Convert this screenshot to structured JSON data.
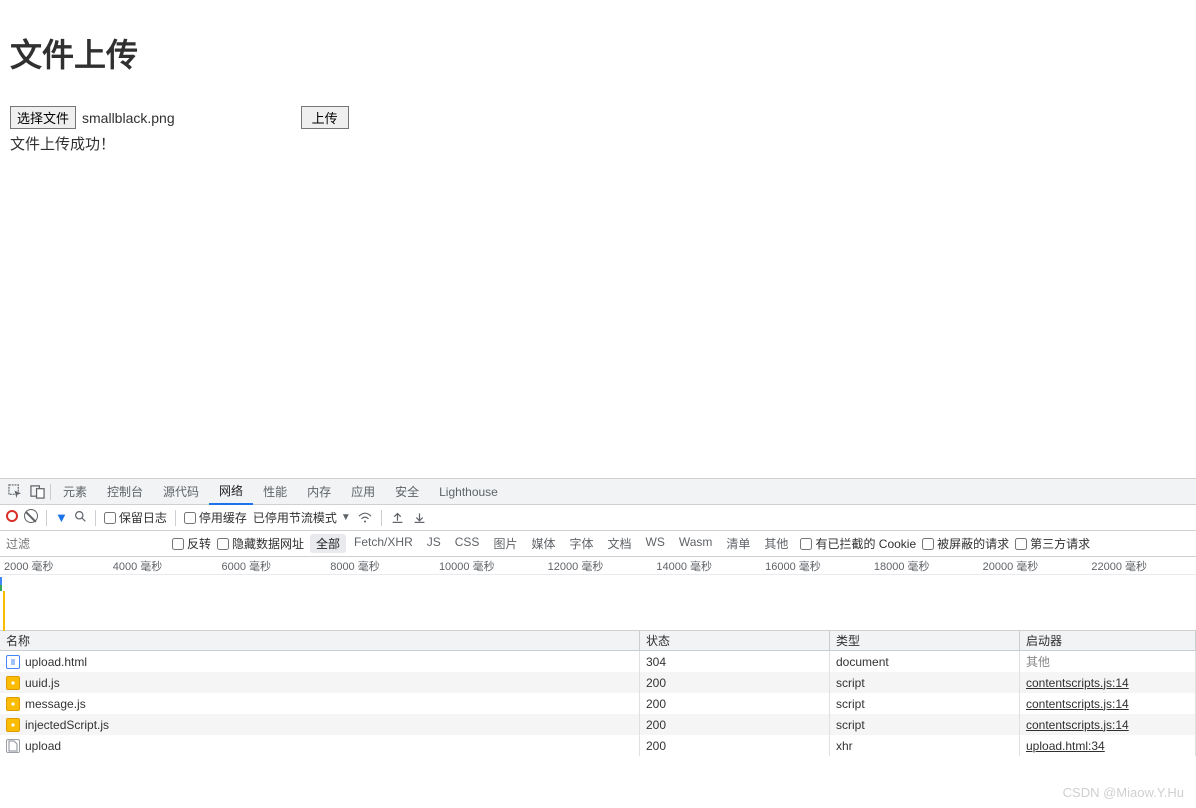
{
  "page": {
    "title": "文件上传",
    "choose_file_btn": "选择文件",
    "filename": "smallblack.png",
    "upload_btn": "上传",
    "success_msg": "文件上传成功！"
  },
  "devtools": {
    "tabs": [
      "元素",
      "控制台",
      "源代码",
      "网络",
      "性能",
      "内存",
      "应用",
      "安全",
      "Lighthouse"
    ],
    "active_tab": "网络",
    "toolbar": {
      "preserve_log": "保留日志",
      "disable_cache": "停用缓存",
      "throttle_label": "已停用节流模式"
    },
    "filter": {
      "placeholder": "过滤",
      "invert": "反转",
      "hide_data_urls": "隐藏数据网址",
      "chips": [
        "全部",
        "Fetch/XHR",
        "JS",
        "CSS",
        "图片",
        "媒体",
        "字体",
        "文档",
        "WS",
        "Wasm",
        "清单",
        "其他"
      ],
      "active_chip": "全部",
      "blocked_cookies": "有已拦截的 Cookie",
      "blocked_requests": "被屏蔽的请求",
      "third_party": "第三方请求"
    },
    "timeline_ticks": [
      "2000 毫秒",
      "4000 毫秒",
      "6000 毫秒",
      "8000 毫秒",
      "10000 毫秒",
      "12000 毫秒",
      "14000 毫秒",
      "16000 毫秒",
      "18000 毫秒",
      "20000 毫秒",
      "22000 毫秒"
    ],
    "columns": {
      "name": "名称",
      "status": "状态",
      "type": "类型",
      "initiator": "启动器"
    },
    "rows": [
      {
        "icon": "doc",
        "name": "upload.html",
        "status": "304",
        "type": "document",
        "initiator": "其他",
        "init_link": false
      },
      {
        "icon": "js",
        "name": "uuid.js",
        "status": "200",
        "type": "script",
        "initiator": "contentscripts.js:14",
        "init_link": true
      },
      {
        "icon": "js",
        "name": "message.js",
        "status": "200",
        "type": "script",
        "initiator": "contentscripts.js:14",
        "init_link": true
      },
      {
        "icon": "js",
        "name": "injectedScript.js",
        "status": "200",
        "type": "script",
        "initiator": "contentscripts.js:14",
        "init_link": true
      },
      {
        "icon": "file",
        "name": "upload",
        "status": "200",
        "type": "xhr",
        "initiator": "upload.html:34",
        "init_link": true
      }
    ]
  },
  "watermark": "CSDN @Miaow.Y.Hu"
}
